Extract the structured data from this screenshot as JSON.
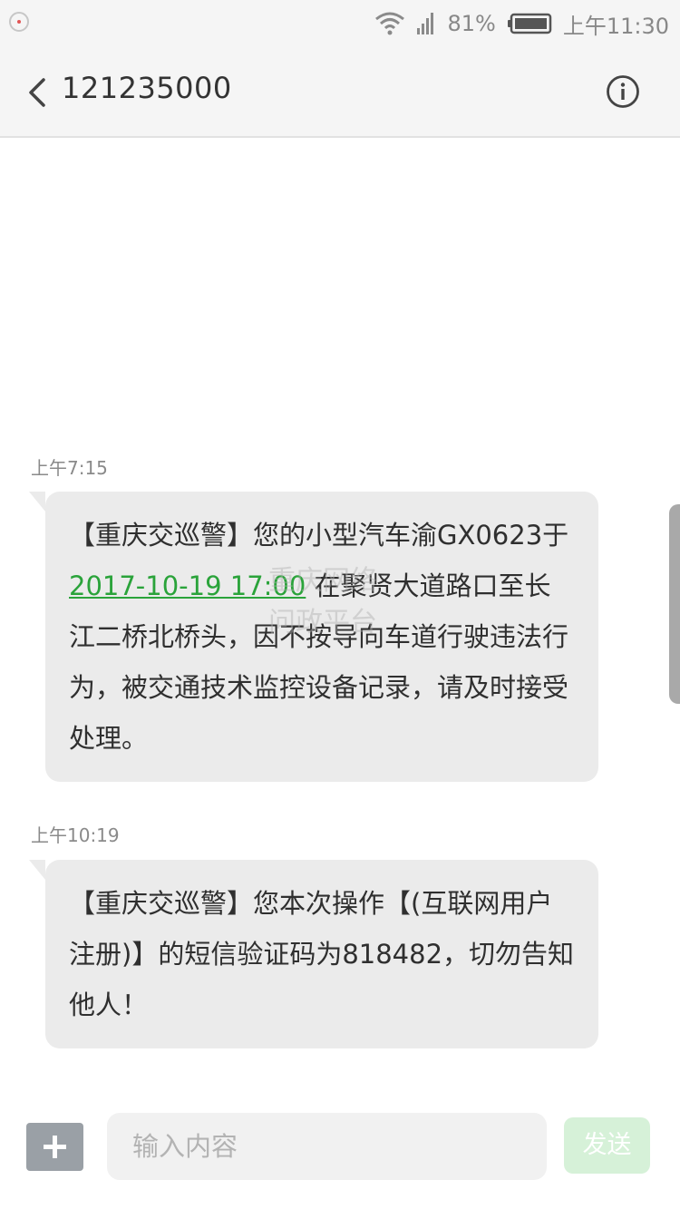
{
  "status_bar": {
    "battery_percent": "81%",
    "time": "上午11:30"
  },
  "header": {
    "contact": "121235000"
  },
  "messages": [
    {
      "timestamp": "上午7:15",
      "text_before": "【重庆交巡警】您的小型汽车渝GX0623于",
      "date_link": "2017-10-19 17:00",
      "text_after": " 在聚贤大道路口至长江二桥北桥头，因不按导向车道行驶违法行为，被交通技术监控设备记录，请及时接受处理。"
    },
    {
      "timestamp": "上午10:19",
      "text": "【重庆交巡警】您本次操作【(互联网用户注册)】的短信验证码为818482，切勿告知他人！"
    }
  ],
  "watermark": {
    "line1": "重庆网络",
    "line2": "问政平台"
  },
  "composer": {
    "placeholder": "输入内容",
    "send_label": "发送"
  },
  "colors": {
    "link": "#2aa33a",
    "bubble": "#ebebeb",
    "send_button": "#d6f1d8"
  }
}
